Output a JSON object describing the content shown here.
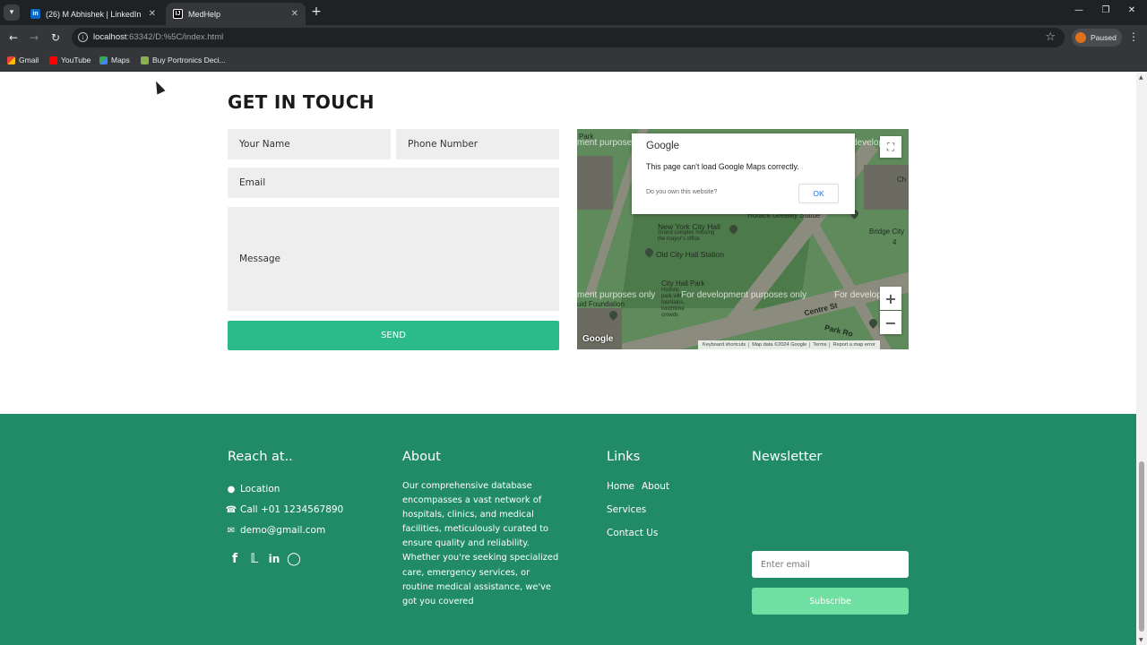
{
  "browser": {
    "tabs": [
      {
        "title": "(26) M Abhishek | LinkedIn",
        "favicon": "in"
      },
      {
        "title": "MedHelp",
        "favicon": "IJ"
      }
    ],
    "url_host": "localhost",
    "url_rest": ":63342/D:%5C/index.html",
    "profile_label": "Paused",
    "bookmarks": [
      "Gmail",
      "YouTube",
      "Maps",
      "Buy Portronics Deci..."
    ]
  },
  "contact": {
    "heading": "GET IN TOUCH",
    "name_placeholder": "Your Name",
    "phone_placeholder": "Phone Number",
    "email_placeholder": "Email",
    "message_placeholder": "Message",
    "send_label": "SEND"
  },
  "map": {
    "dialog_brand": "Google",
    "dialog_message": "This page can't load Google Maps correctly.",
    "dialog_question": "Do you own this website?",
    "dialog_ok": "OK",
    "dev_text_left_top": "ment purposes",
    "dev_text_right_top": "develop",
    "dev_text_1": "ment purposes only",
    "dev_text_2": "For development purposes only",
    "dev_text_3": "For develop",
    "labels": {
      "park": "Park",
      "city_hall": "New York City Hall",
      "city_hall_sub": "Grand complex housing\nthe mayor's office",
      "old_station": "Old City Hall Station",
      "city_hall_park": "City Hall Park",
      "city_hall_park_sub": "Historic\npark with\nfountains,\nlunchtime\ncrowds",
      "horace": "Horace Greeley Statue",
      "bridge": "Bridge City",
      "centre": "Centre St",
      "park_row": "Park Ro",
      "ch": "Ch",
      "uid": "uid Foundation",
      "four": "4"
    },
    "google_logo": "Google",
    "attribution": [
      "Keyboard shortcuts",
      "Map data ©2024 Google",
      "Terms",
      "Report a map error"
    ]
  },
  "footer": {
    "reach": {
      "heading": "Reach at..",
      "location": "Location",
      "phone": "Call +01 1234567890",
      "email": "demo@gmail.com"
    },
    "about": {
      "heading": "About",
      "text": "Our comprehensive database encompasses a vast network of hospitals, clinics, and medical facilities, meticulously curated to ensure quality and reliability. Whether you're seeking specialized care, emergency services, or routine medical assistance, we've got you covered"
    },
    "links": {
      "heading": "Links",
      "home": "Home",
      "about": "About",
      "services": "Services",
      "contact": "Contact Us"
    },
    "newsletter": {
      "heading": "Newsletter",
      "email_placeholder": "Enter email",
      "subscribe_label": "Subscribe"
    }
  },
  "colors": {
    "accent_green": "#2bbb8a",
    "footer_bg": "#218b67",
    "subscribe_bg": "#6fe0a1"
  }
}
